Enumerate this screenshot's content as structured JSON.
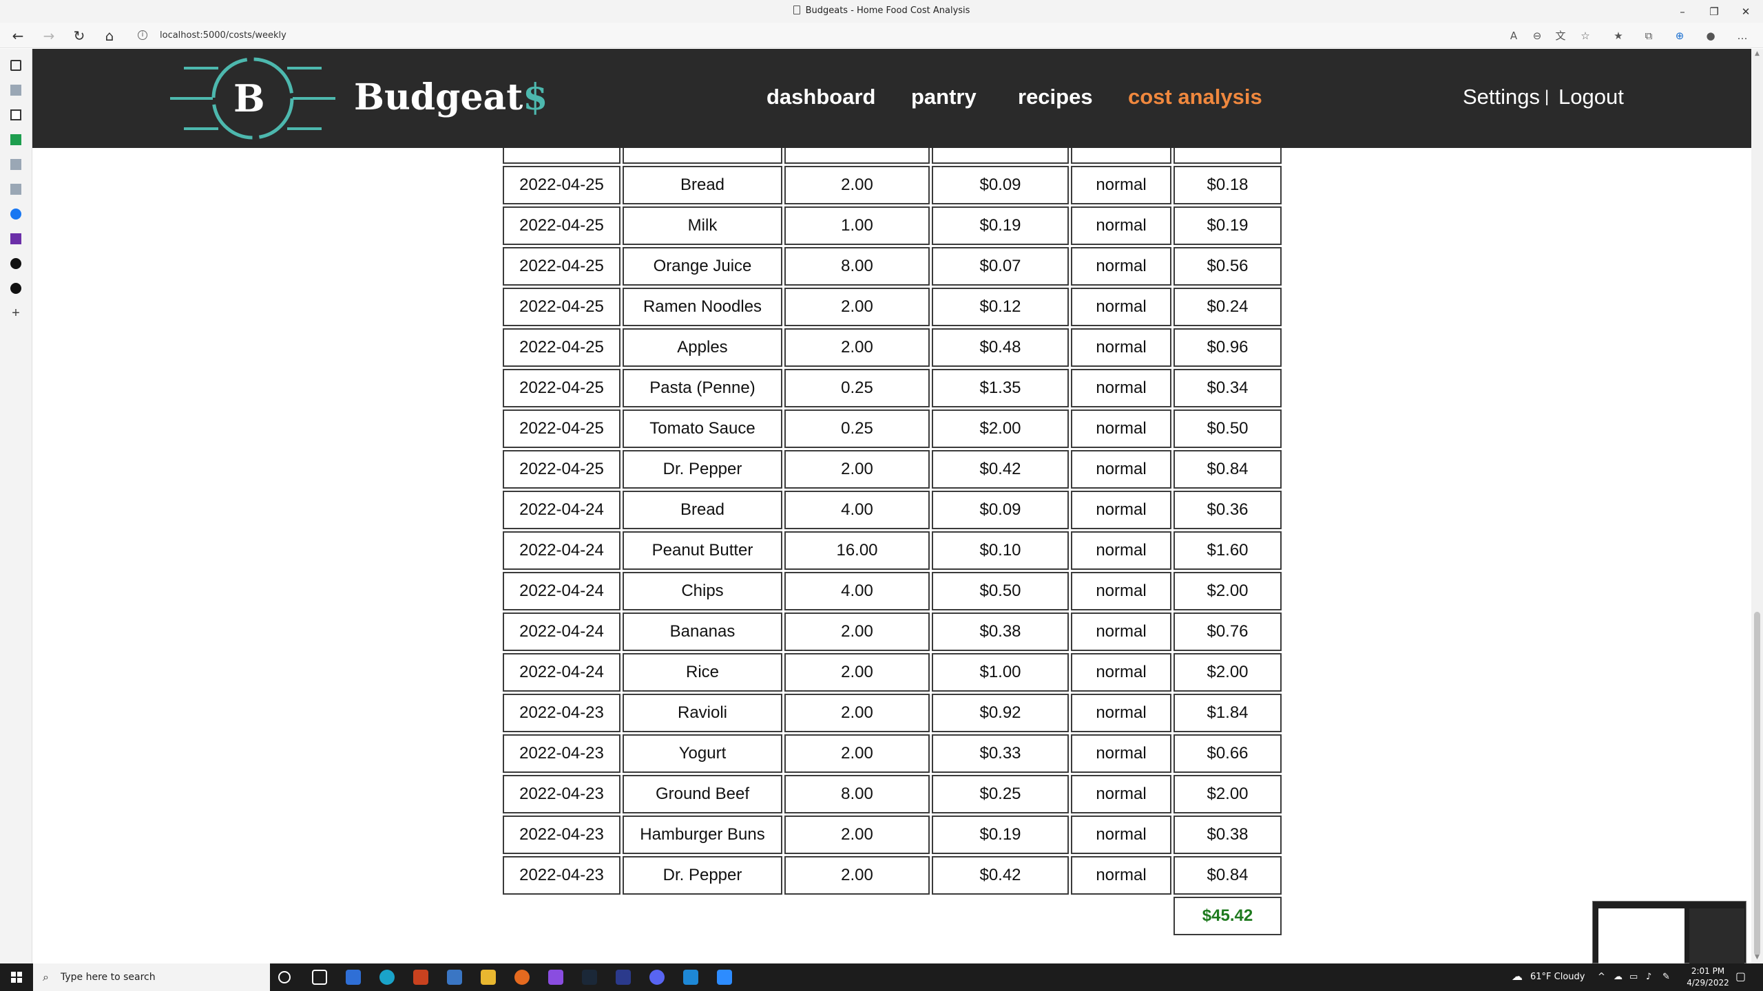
{
  "browser": {
    "title": "Budgeats - Home Food Cost Analysis",
    "url": "localhost:5000/costs/weekly"
  },
  "app": {
    "logo_letter": "B",
    "brand_name": "Budgeat",
    "brand_suffix": "$",
    "brand_colors": {
      "nav_bg": "#2a2a2a",
      "teal": "#4db8ae",
      "active": "#f0883e",
      "total": "#1e7a1e"
    },
    "nav": {
      "dashboard": "dashboard",
      "pantry": "pantry",
      "recipes": "recipes",
      "cost_analysis": "cost analysis",
      "active": "cost analysis",
      "settings": "Settings",
      "separator": "|",
      "logout": "Logout"
    }
  },
  "costs": {
    "rows": [
      {
        "date": "",
        "item": "",
        "qty": "",
        "unit_cost": "",
        "type": "",
        "cost": ""
      },
      {
        "date": "2022-04-25",
        "item": "Bread",
        "qty": "2.00",
        "unit_cost": "$0.09",
        "type": "normal",
        "cost": "$0.18"
      },
      {
        "date": "2022-04-25",
        "item": "Milk",
        "qty": "1.00",
        "unit_cost": "$0.19",
        "type": "normal",
        "cost": "$0.19"
      },
      {
        "date": "2022-04-25",
        "item": "Orange Juice",
        "qty": "8.00",
        "unit_cost": "$0.07",
        "type": "normal",
        "cost": "$0.56"
      },
      {
        "date": "2022-04-25",
        "item": "Ramen Noodles",
        "qty": "2.00",
        "unit_cost": "$0.12",
        "type": "normal",
        "cost": "$0.24"
      },
      {
        "date": "2022-04-25",
        "item": "Apples",
        "qty": "2.00",
        "unit_cost": "$0.48",
        "type": "normal",
        "cost": "$0.96"
      },
      {
        "date": "2022-04-25",
        "item": "Pasta (Penne)",
        "qty": "0.25",
        "unit_cost": "$1.35",
        "type": "normal",
        "cost": "$0.34"
      },
      {
        "date": "2022-04-25",
        "item": "Tomato Sauce",
        "qty": "0.25",
        "unit_cost": "$2.00",
        "type": "normal",
        "cost": "$0.50"
      },
      {
        "date": "2022-04-25",
        "item": "Dr. Pepper",
        "qty": "2.00",
        "unit_cost": "$0.42",
        "type": "normal",
        "cost": "$0.84"
      },
      {
        "date": "2022-04-24",
        "item": "Bread",
        "qty": "4.00",
        "unit_cost": "$0.09",
        "type": "normal",
        "cost": "$0.36"
      },
      {
        "date": "2022-04-24",
        "item": "Peanut Butter",
        "qty": "16.00",
        "unit_cost": "$0.10",
        "type": "normal",
        "cost": "$1.60"
      },
      {
        "date": "2022-04-24",
        "item": "Chips",
        "qty": "4.00",
        "unit_cost": "$0.50",
        "type": "normal",
        "cost": "$2.00"
      },
      {
        "date": "2022-04-24",
        "item": "Bananas",
        "qty": "2.00",
        "unit_cost": "$0.38",
        "type": "normal",
        "cost": "$0.76"
      },
      {
        "date": "2022-04-24",
        "item": "Rice",
        "qty": "2.00",
        "unit_cost": "$1.00",
        "type": "normal",
        "cost": "$2.00"
      },
      {
        "date": "2022-04-23",
        "item": "Ravioli",
        "qty": "2.00",
        "unit_cost": "$0.92",
        "type": "normal",
        "cost": "$1.84"
      },
      {
        "date": "2022-04-23",
        "item": "Yogurt",
        "qty": "2.00",
        "unit_cost": "$0.33",
        "type": "normal",
        "cost": "$0.66"
      },
      {
        "date": "2022-04-23",
        "item": "Ground Beef",
        "qty": "8.00",
        "unit_cost": "$0.25",
        "type": "normal",
        "cost": "$2.00"
      },
      {
        "date": "2022-04-23",
        "item": "Hamburger Buns",
        "qty": "2.00",
        "unit_cost": "$0.19",
        "type": "normal",
        "cost": "$0.38"
      },
      {
        "date": "2022-04-23",
        "item": "Dr. Pepper",
        "qty": "2.00",
        "unit_cost": "$0.42",
        "type": "normal",
        "cost": "$0.84"
      }
    ],
    "total": "$45.42"
  },
  "taskbar": {
    "search_placeholder": "Type here to search",
    "weather": "61°F  Cloudy",
    "time": "2:01 PM",
    "date": "4/29/2022"
  }
}
